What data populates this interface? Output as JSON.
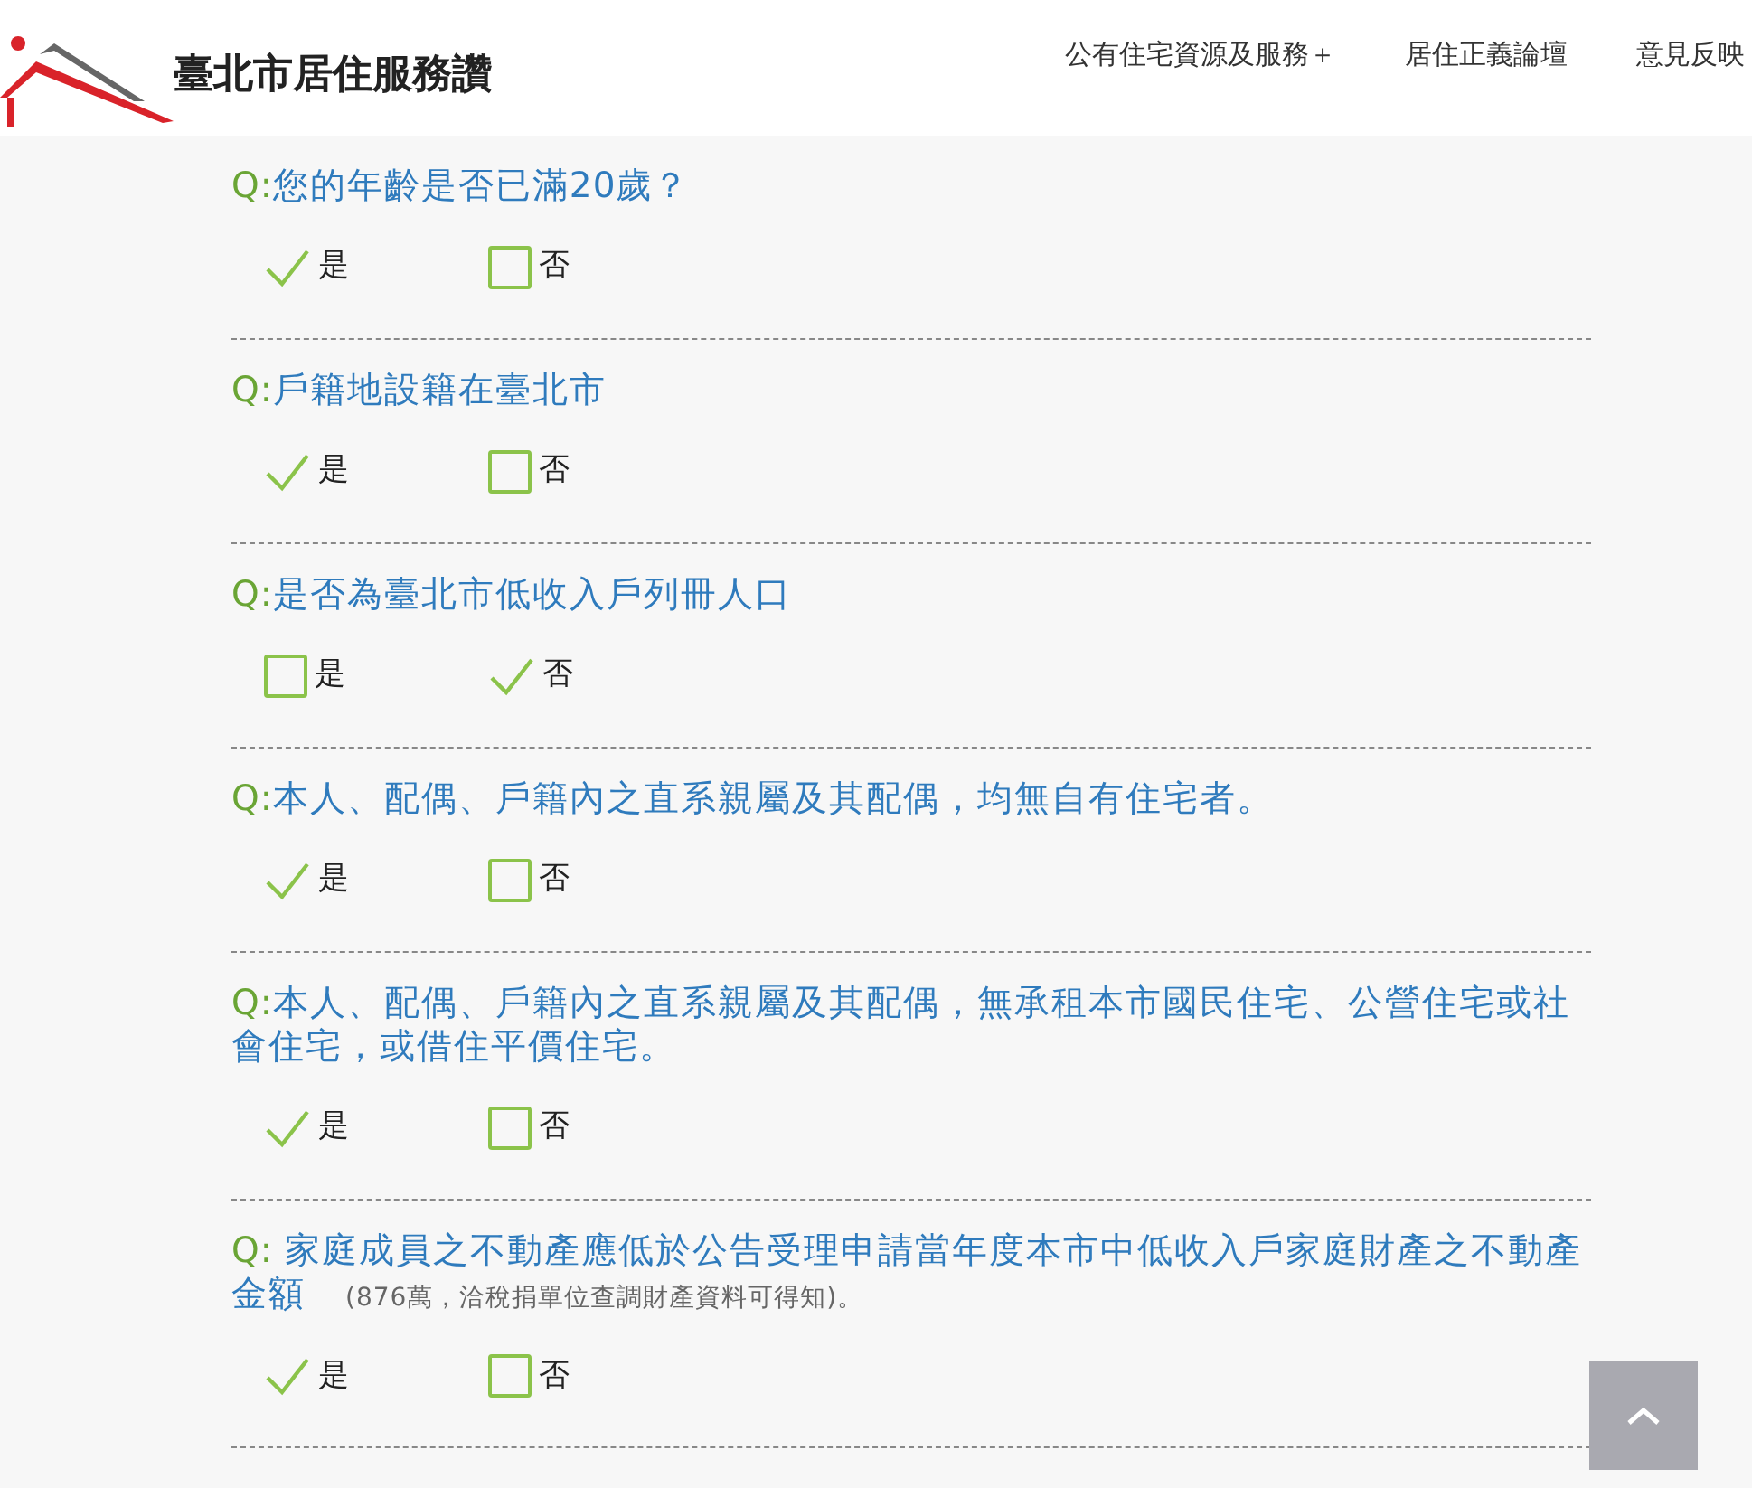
{
  "header": {
    "site_title": "臺北市居住服務讚",
    "nav": [
      {
        "label": "公有住宅資源及服務＋"
      },
      {
        "label": "居住正義論壇"
      },
      {
        "label": "意見反映"
      }
    ]
  },
  "questions": [
    {
      "prefix": "Q:",
      "text": "您的年齡是否已滿20歲？",
      "options": [
        {
          "label": "是",
          "checked": true
        },
        {
          "label": "否",
          "checked": false
        }
      ]
    },
    {
      "prefix": "Q:",
      "text": "戶籍地設籍在臺北市",
      "options": [
        {
          "label": "是",
          "checked": true
        },
        {
          "label": "否",
          "checked": false
        }
      ]
    },
    {
      "prefix": "Q:",
      "text": "是否為臺北市低收入戶列冊人口",
      "options": [
        {
          "label": "是",
          "checked": false
        },
        {
          "label": "否",
          "checked": true
        }
      ]
    },
    {
      "prefix": "Q:",
      "text": "本人、配偶、戶籍內之直系親屬及其配偶，均無自有住宅者。",
      "options": [
        {
          "label": "是",
          "checked": true
        },
        {
          "label": "否",
          "checked": false
        }
      ]
    },
    {
      "prefix": "Q:",
      "text": "本人、配偶、戶籍內之直系親屬及其配偶，無承租本市國民住宅、公營住宅或社會住宅，或借住平價住宅。",
      "options": [
        {
          "label": "是",
          "checked": true
        },
        {
          "label": "否",
          "checked": false
        }
      ]
    },
    {
      "prefix": "Q: ",
      "text": "家庭成員之不動產應低於公告受理申請當年度本市中低收入戶家庭財產之不動產金額",
      "note": "(876萬，洽稅捐單位查調財產資料可得知)。",
      "options": [
        {
          "label": "是",
          "checked": true
        },
        {
          "label": "否",
          "checked": false
        }
      ]
    }
  ]
}
